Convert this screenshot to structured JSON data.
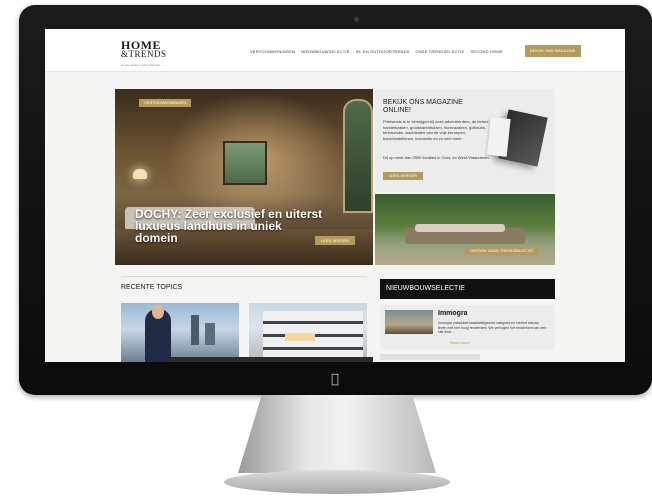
{
  "site": {
    "logo_main": "HOME",
    "logo_sub": "&TRENDS",
    "logo_tagline": "wonen anders wonen lifestyle",
    "nav": [
      "VERTOONWONINGEN",
      "NIEUWBOUWSELECTIE",
      "IN- EN OUTDOORTRENDS",
      "ONZE TRENDSELECTIE",
      "SECOND HOME"
    ],
    "nav_cta": "BEKIJK ONS MAGAZINE"
  },
  "hero": {
    "badge": "VERTOONWONINGEN",
    "title": "DOCHY: Zeer exclusief en uiterst luxueus landhuis in uniek domein",
    "button": "LEES VERDER"
  },
  "promo": {
    "title": "BEKIJK ONS MAGAZINE ONLINE!",
    "text": "Printversie is te verkrijgen bij onze adverteerders, de betere handelszaken, grootwarenhuizen, horecazaken, golfclubs, tennisclubs, wachtzalen van de vrije beroepen, banchinstelinnen, luxeamits en zo veel meer.",
    "text2": "Dit op meer dan 2500 locaties in Oost- en West-Vlaanderen.",
    "button": "LEES VERDER"
  },
  "garden": {
    "button": "ONTDEK ONZE TRENDSELECTIE"
  },
  "topics": {
    "title": "RECENTE TOPICS"
  },
  "nieuwbouw": {
    "title": "NIEUWBOUWSELECTIE",
    "name": "Immogra",
    "desc": "Immogra ontwikkelt kwalitatiefgericht vastgoed en creëert nieuwe leven met een hoog rendement. We verhogen het rendement van een site door...",
    "link": "Read more"
  },
  "colors": {
    "accent": "#b39a5f",
    "dark_bar": "#111111"
  }
}
